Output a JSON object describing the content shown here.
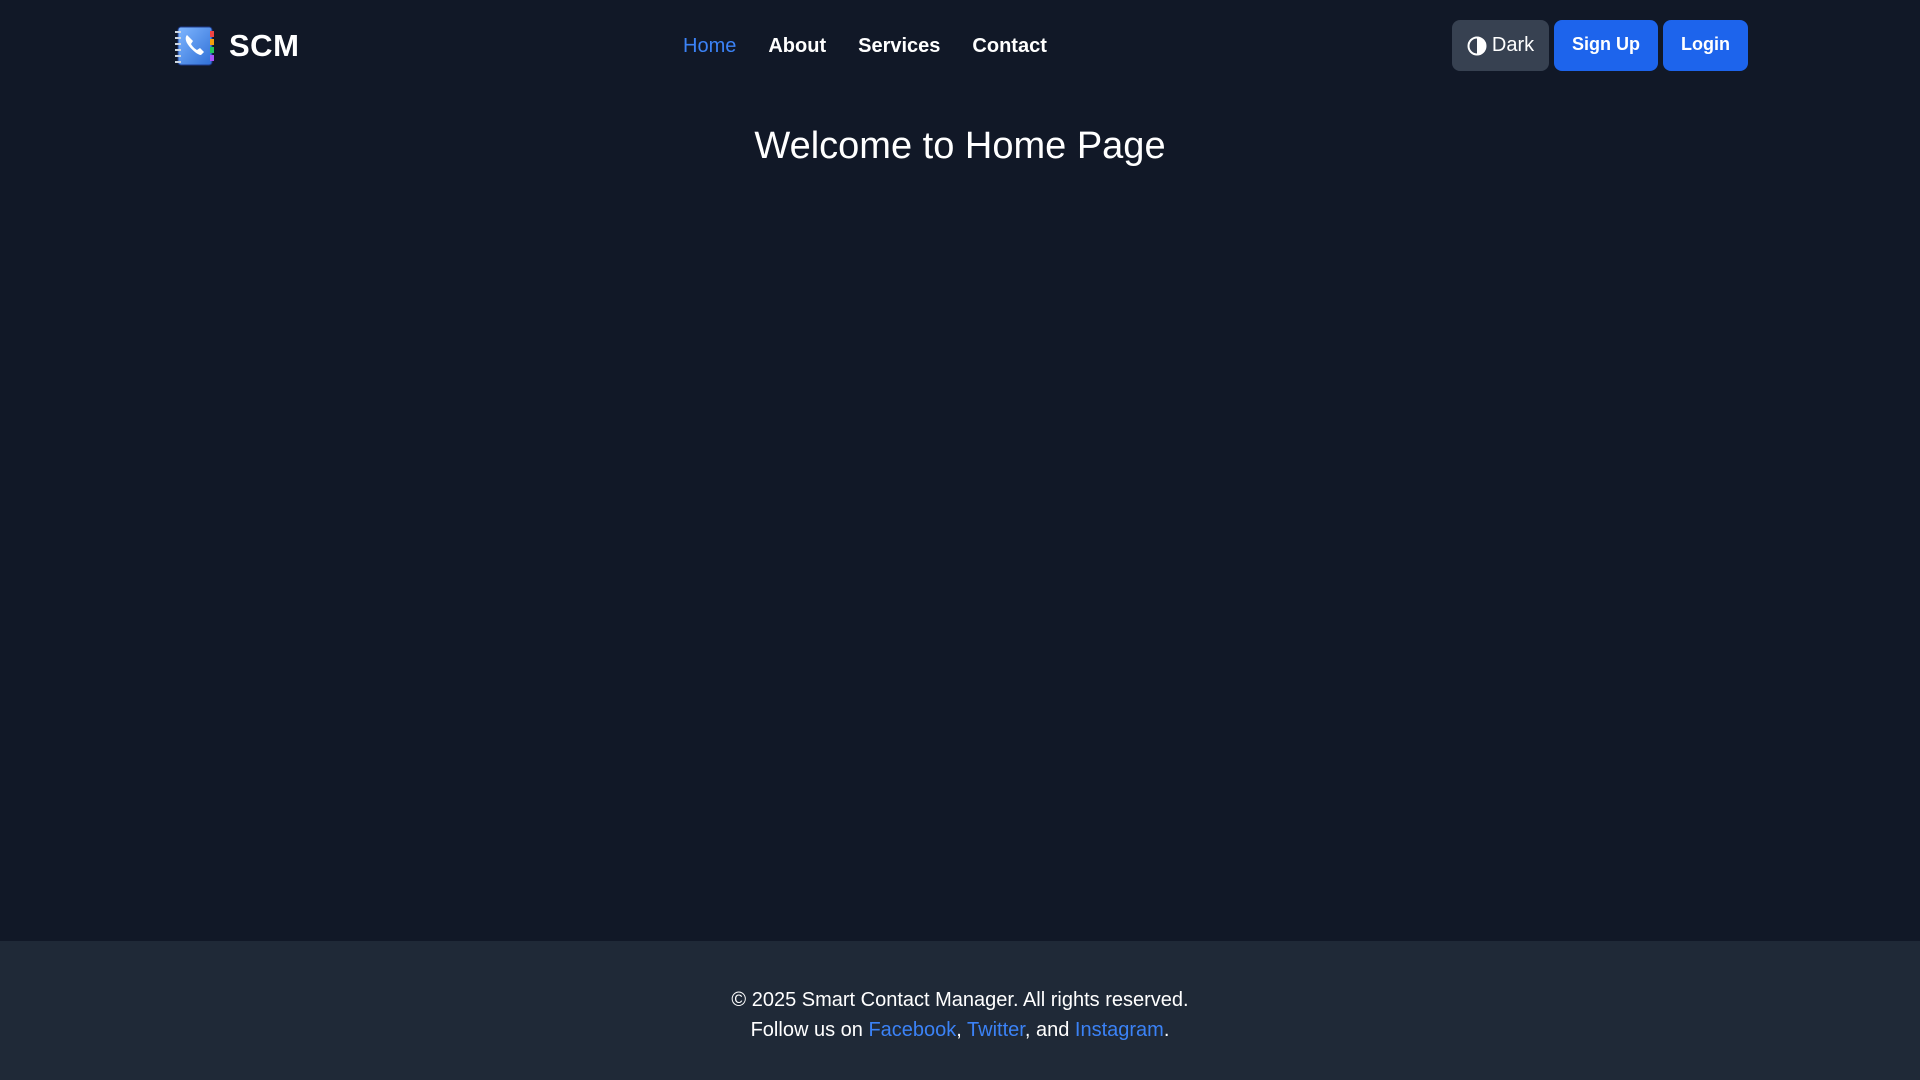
{
  "brand": {
    "name": "SCM",
    "logo_icon": "contact-book-icon"
  },
  "nav": {
    "links": [
      {
        "label": "Home",
        "active": true
      },
      {
        "label": "About",
        "active": false
      },
      {
        "label": "Services",
        "active": false
      },
      {
        "label": "Contact",
        "active": false
      }
    ]
  },
  "actions": {
    "theme_toggle_label": "Dark",
    "theme_toggle_icon": "half-circle-contrast-icon",
    "signup_label": "Sign Up",
    "login_label": "Login"
  },
  "main": {
    "title": "Welcome to Home Page"
  },
  "footer": {
    "copyright": "© 2025 Smart Contact Manager. All rights reserved.",
    "follow_prefix": "Follow us on ",
    "facebook": "Facebook",
    "separator_1": ", ",
    "twitter": "Twitter",
    "separator_2": ", and ",
    "instagram": "Instagram",
    "suffix": "."
  },
  "colors": {
    "background": "#111827",
    "footer_background": "#1f2937",
    "accent": "#3b82f6",
    "primary_button": "#1d64ec",
    "toggle_button": "#374151"
  }
}
